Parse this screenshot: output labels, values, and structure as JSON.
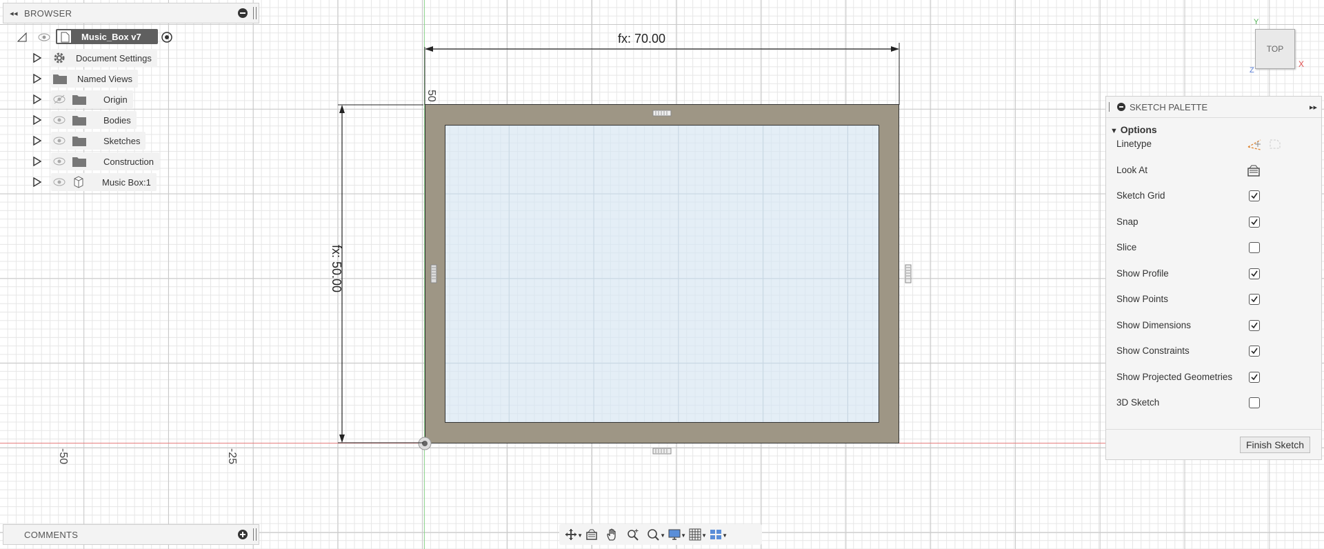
{
  "browser": {
    "header": "BROWSER",
    "root": {
      "label": "Music_Box v7"
    },
    "items": [
      {
        "label": "Document Settings",
        "icon": "gear-icon"
      },
      {
        "label": "Named Views",
        "icon": "folder-icon"
      },
      {
        "label": "Origin",
        "icon": "folder-icon",
        "hidden": true
      },
      {
        "label": "Bodies",
        "icon": "folder-icon"
      },
      {
        "label": "Sketches",
        "icon": "folder-icon"
      },
      {
        "label": "Construction",
        "icon": "folder-icon"
      },
      {
        "label": "Music Box:1",
        "icon": "component-icon"
      }
    ]
  },
  "comments": {
    "header": "COMMENTS"
  },
  "canvas": {
    "width_dim": "fx: 70.00",
    "height_dim": "fx: 50.00",
    "axis_label_x1": "-50",
    "axis_label_x2": "-25",
    "axis_label_top": "50"
  },
  "viewcube": {
    "face": "TOP",
    "x_axis": "X",
    "y_axis": "Y",
    "z_axis": "Z"
  },
  "palette": {
    "header": "SKETCH PALETTE",
    "section": "Options",
    "rows": [
      {
        "label": "Linetype"
      },
      {
        "label": "Look At"
      },
      {
        "label": "Sketch Grid",
        "checked": true
      },
      {
        "label": "Snap",
        "checked": true
      },
      {
        "label": "Slice",
        "checked": false
      },
      {
        "label": "Show Profile",
        "checked": true
      },
      {
        "label": "Show Points",
        "checked": true
      },
      {
        "label": "Show Dimensions",
        "checked": true
      },
      {
        "label": "Show Constraints",
        "checked": true
      },
      {
        "label": "Show Projected Geometries",
        "checked": true
      },
      {
        "label": "3D Sketch",
        "checked": false
      }
    ],
    "finish_label": "Finish Sketch"
  },
  "colors": {
    "frame": "#9e9685",
    "profile": "#e4eef6",
    "x_axis": "#e57c7c",
    "y_axis": "#8fd48f"
  }
}
